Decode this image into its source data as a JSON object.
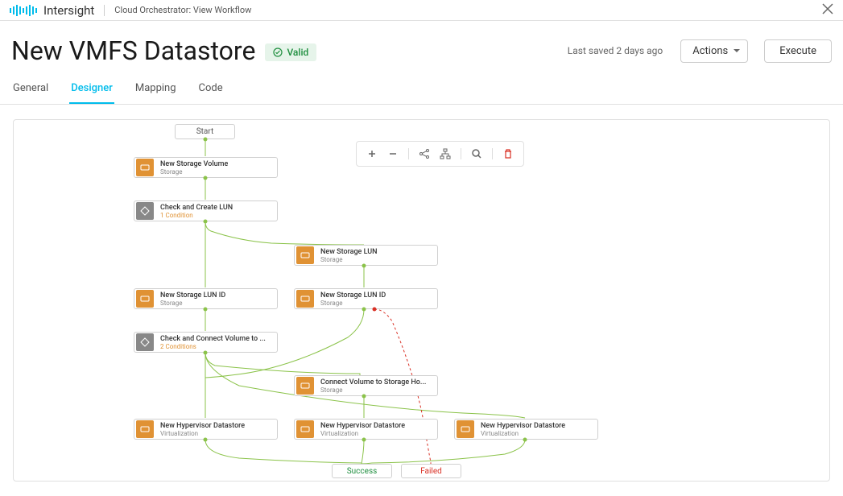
{
  "header": {
    "brand": "Intersight",
    "breadcrumb": "Cloud Orchestrator: View Workflow"
  },
  "page": {
    "title": "New VMFS Datastore",
    "status": "Valid",
    "last_saved": "Last saved 2 days ago",
    "actions_label": "Actions",
    "execute_label": "Execute"
  },
  "tabs": {
    "general": "General",
    "designer": "Designer",
    "mapping": "Mapping",
    "code": "Code"
  },
  "nodes": {
    "start": "Start",
    "success": "Success",
    "failed": "Failed",
    "new_storage_volume": {
      "title": "New Storage Volume",
      "subtitle": "Storage"
    },
    "check_create_lun": {
      "title": "Check and Create LUN",
      "subtitle": "1 Condition"
    },
    "new_storage_lun": {
      "title": "New Storage LUN",
      "subtitle": "Storage"
    },
    "new_storage_lun_id_left": {
      "title": "New Storage LUN ID",
      "subtitle": "Storage"
    },
    "new_storage_lun_id_right": {
      "title": "New Storage LUN ID",
      "subtitle": "Storage"
    },
    "check_connect_volume": {
      "title": "Check and Connect Volume to ...",
      "subtitle": "2 Conditions"
    },
    "connect_volume": {
      "title": "Connect Volume to Storage Ho...",
      "subtitle": "Storage"
    },
    "new_hypervisor_ds_1": {
      "title": "New Hypervisor Datastore",
      "subtitle": "Virtualization"
    },
    "new_hypervisor_ds_2": {
      "title": "New Hypervisor Datastore",
      "subtitle": "Virtualization"
    },
    "new_hypervisor_ds_3": {
      "title": "New Hypervisor Datastore",
      "subtitle": "Virtualization"
    }
  }
}
